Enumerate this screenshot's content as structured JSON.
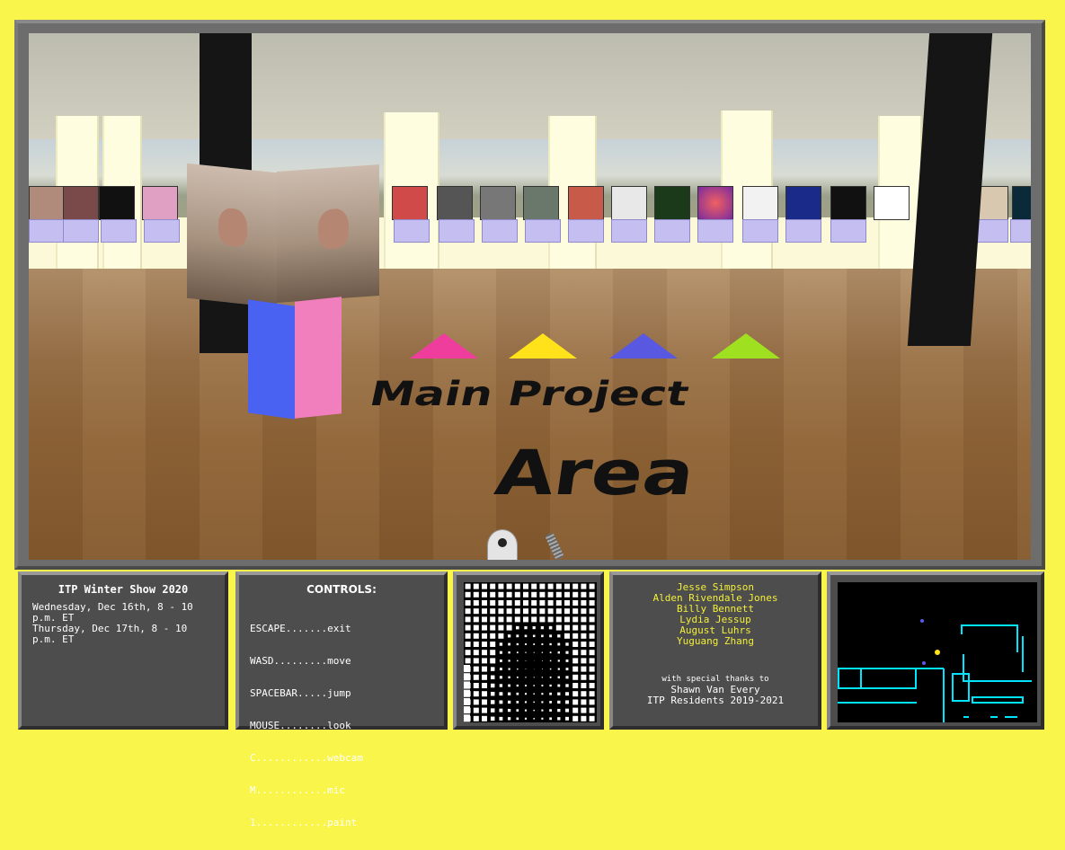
{
  "scene": {
    "floor_text_line1": "Main Project",
    "floor_text_line2": "Area",
    "triangle_colors": [
      "#ef3d9e",
      "#ffe21a",
      "#5859e0",
      "#9fe021"
    ],
    "cube_colors": {
      "left": "#4a62f2",
      "right": "#f27fbd"
    }
  },
  "info_panel": {
    "title": "ITP Winter Show 2020",
    "line1": "Wednesday, Dec 16th, 8 - 10",
    "line2": "p.m. ET",
    "line3": "Thursday, Dec 17th, 8 - 10",
    "line4": "p.m. ET"
  },
  "controls_panel": {
    "title": "CONTROLS:",
    "items": [
      "ESCAPE.......exit",
      "WASD.........move",
      "SPACEBAR.....jump",
      "MOUSE........look",
      "C............webcam",
      "M............mic",
      "1............paint"
    ]
  },
  "credits_panel": {
    "names": [
      "Jesse Simpson",
      "Alden Rivendale Jones",
      "Billy Bennett",
      "Lydia Jessup",
      "August Luhrs",
      "Yuguang Zhang"
    ],
    "thanks_intro": "with special thanks to",
    "thanks1": "Shawn Van Every",
    "thanks2": "ITP Residents 2019-2021"
  },
  "minimap": {
    "wall_color": "#00e5ff",
    "player_color": "#ffe21a",
    "other_color": "#5a5ae8"
  }
}
